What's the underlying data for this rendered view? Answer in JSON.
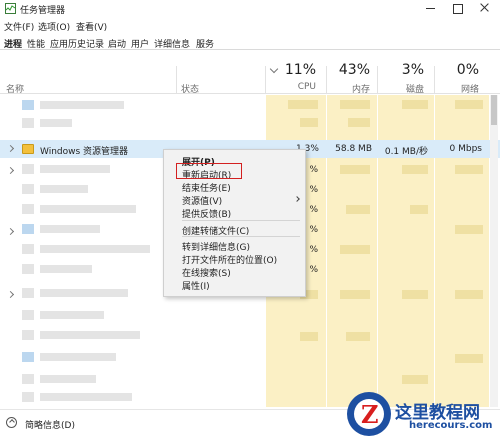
{
  "window": {
    "title": "任务管理器",
    "icon": "task-manager-icon"
  },
  "menu": [
    "文件(F)",
    "选项(O)",
    "查看(V)"
  ],
  "tabs": [
    "进程",
    "性能",
    "应用历史记录",
    "启动",
    "用户",
    "详细信息",
    "服务"
  ],
  "columns": {
    "name": "名称",
    "status": "状态",
    "cpu": {
      "pct": "11%",
      "label": "CPU"
    },
    "memory": {
      "pct": "43%",
      "label": "内存"
    },
    "disk": {
      "pct": "3%",
      "label": "磁盘"
    },
    "network": {
      "pct": "0%",
      "label": "网络"
    }
  },
  "selected_row": {
    "name": "Windows 资源管理器",
    "cpu": "1.3%",
    "memory": "58.8 MB",
    "disk": "0.1 MB/秒",
    "network": "0 Mbps"
  },
  "context_menu": {
    "expand": "展开(P)",
    "restart": "重新启动(R)",
    "end_task": "结束任务(E)",
    "resource_values": "资源值(V)",
    "feedback": "提供反馈(B)",
    "create_dump": "创建转储文件(C)",
    "go_details": "转到详细信息(G)",
    "open_location": "打开文件所在的位置(O)",
    "search_online": "在线搜索(S)",
    "properties": "属性(I)"
  },
  "partial_cpu_cells": [
    "%",
    "%",
    "%",
    "%",
    "%",
    "%"
  ],
  "footer": {
    "label": "简略信息(D)"
  },
  "watermark": {
    "text_cn": "这里教程网",
    "url": "herecours.com"
  },
  "colors": {
    "heat": "#fbf0c5",
    "selection": "#d9ebf9",
    "highlight": "#d32020",
    "watermark": "#1d4fa1"
  }
}
